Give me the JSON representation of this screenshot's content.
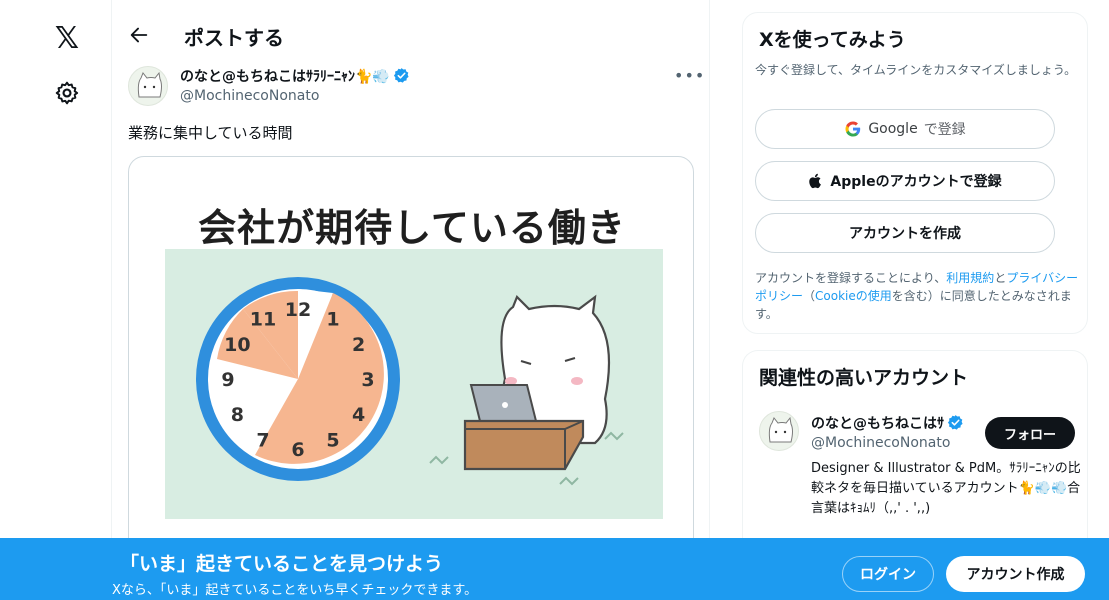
{
  "nav": {
    "logo": "𝕏"
  },
  "header": {
    "title": "ポストする"
  },
  "post": {
    "author_name": "のなと@もちねこはｻﾗﾘｰﾆｬﾝ🐈💨",
    "author_handle": "@MochinecoNonato",
    "text": "業務に集中している時間",
    "image_title": "会社が期待している働き",
    "clock_numbers": [
      "12",
      "1",
      "2",
      "3",
      "4",
      "5",
      "6",
      "7",
      "8",
      "9",
      "10",
      "11"
    ]
  },
  "signup_card": {
    "title": "Xを使ってみよう",
    "subtitle": "今すぐ登録して、タイムラインをカスタマイズしましょう。",
    "google_label": "Google",
    "google_suffix": "で登録",
    "apple_label": "Appleのアカウントで登録",
    "create_label": "アカウントを作成",
    "terms_prefix": "アカウントを登録することにより、",
    "terms_link": "利用規約",
    "terms_and": "と",
    "privacy_link": "プライバシーポリシー",
    "cookie_open": "（",
    "cookie_link": "Cookieの使用",
    "cookie_close": "を含む）に同意したとみなされます。"
  },
  "related": {
    "title": "関連性の高いアカウント",
    "name": "のなと@もちねこはｻ",
    "handle": "@MochinecoNonato",
    "follow_label": "フォロー",
    "bio": "Designer & Illustrator & PdM。ｻﾗﾘｰﾆｬﾝの比較ネタを毎日描いているアカウント🐈💨💨合言葉はｷｮﾑﾘ（,,' . ',,)"
  },
  "banner": {
    "title": "「いま」起きていることを見つけよう",
    "subtitle": "Xなら、「いま」起きていることをいち早くチェックできます。",
    "login_label": "ログイン",
    "signup_label": "アカウント作成"
  },
  "colors": {
    "accent": "#1d9bf0",
    "clock_ring": "#2f8fdd",
    "clock_fill": "#f6b690",
    "image_bg": "#d8ede2"
  }
}
